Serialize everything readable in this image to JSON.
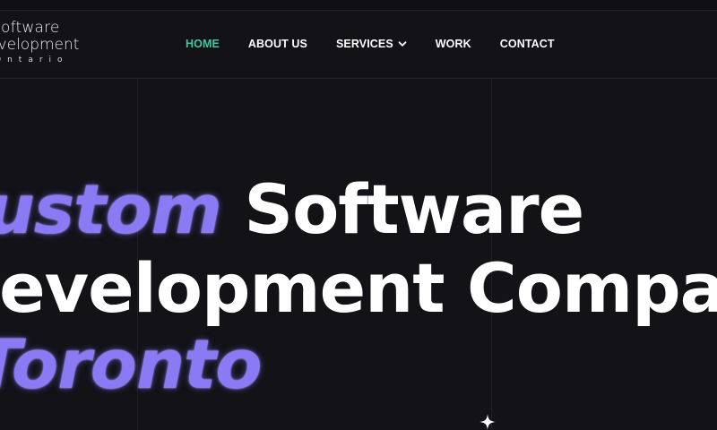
{
  "logo": {
    "line1": "Software",
    "line2": "Development",
    "line3": "Ontario"
  },
  "nav": {
    "items": [
      {
        "label": "HOME",
        "active": true
      },
      {
        "label": "ABOUT US"
      },
      {
        "label": "SERVICES",
        "dropdown": true
      },
      {
        "label": "WORK"
      },
      {
        "label": "CONTACT"
      }
    ]
  },
  "hero": {
    "line1_accent": "Custom",
    "line1_rest": "Software",
    "line2": "Development Company",
    "line3_accent": "Toronto"
  },
  "colors": {
    "background": "#121217",
    "accent": "#8a7bf5",
    "nav_active": "#3cc99a",
    "text": "#ffffff"
  },
  "icons": {
    "dropdown": "chevron-down-icon",
    "decoration": "sparkle-icon"
  }
}
